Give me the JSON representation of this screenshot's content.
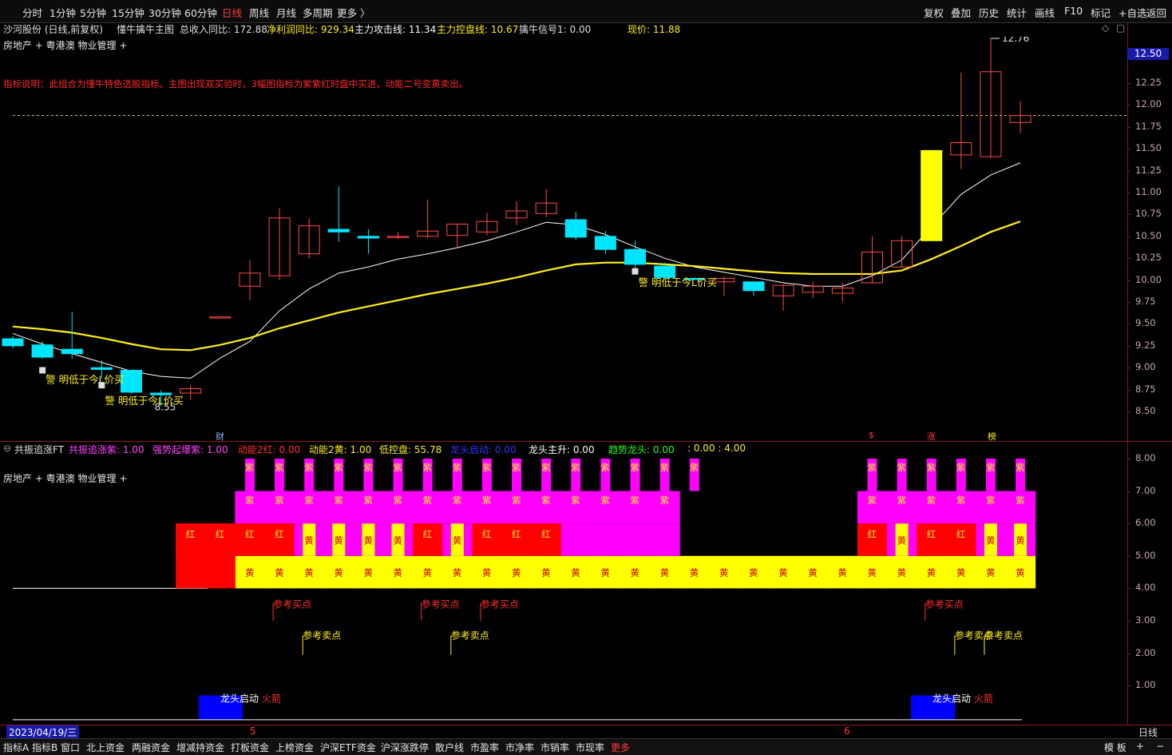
{
  "topbar": {
    "periods": [
      "分时",
      "1分钟",
      "5分钟",
      "15分钟",
      "30分钟",
      "60分钟",
      "日线",
      "周线",
      "月线",
      "多周期",
      "更多 〉"
    ],
    "active_period": "日线",
    "right_buttons": [
      "复权",
      "叠加",
      "历史",
      "统计",
      "画线",
      "F10",
      "标记",
      "+自选",
      "返回"
    ]
  },
  "main_info": {
    "stock": "沙河股份 (日线,前复权)",
    "indicator": "懂牛擒牛主图",
    "revenue_yoy": "总收入同比: 172.88",
    "profit_yoy": "净利润同比: 929.34",
    "attack_line": "主力攻击线: 11.34",
    "control_line": "主力控盘线: 10.67",
    "signal1": "擒牛信号1: 0.00",
    "price": "现价: 11.88",
    "sector": "房地产 + 粤港澳 物业管理 +",
    "description": "指标说明：此组合为懂牛特色选股指标。主图出现双买验时，3幅图指标为紫紫红时盘中买进，动能二号变黄卖出。"
  },
  "colors": {
    "up": "#ff4b4b",
    "down": "#00e5ff",
    "attack": "#ffffff",
    "control": "#ffee22",
    "purple": "#ff00ff",
    "red": "#ff0000",
    "yellow": "#ffff00",
    "blue": "#0000ff",
    "axis": "#7a1a1a"
  },
  "price_axis": {
    "labels": [
      "12.50",
      "12.25",
      "12.00",
      "11.75",
      "11.50",
      "11.25",
      "11.00",
      "10.75",
      "10.50",
      "10.25",
      "10.00",
      "9.75",
      "9.50",
      "9.25",
      "9.00",
      "8.75",
      "8.50"
    ],
    "current": "12.50",
    "high_label": "12.76",
    "low_label": "8.55"
  },
  "chart_data": [
    {
      "type": "candlestick",
      "title": "懂牛擒牛主图",
      "ylim": [
        8.4,
        12.85
      ],
      "candles": [
        {
          "o": 9.33,
          "h": 9.36,
          "l": 9.22,
          "c": 9.25
        },
        {
          "o": 9.26,
          "h": 9.3,
          "l": 9.1,
          "c": 9.12
        },
        {
          "o": 9.21,
          "h": 9.64,
          "l": 9.1,
          "c": 9.16
        },
        {
          "o": 9.0,
          "h": 9.08,
          "l": 8.88,
          "c": 8.98
        },
        {
          "o": 8.97,
          "h": 8.98,
          "l": 8.7,
          "c": 8.72
        },
        {
          "o": 8.71,
          "h": 8.74,
          "l": 8.56,
          "c": 8.69
        },
        {
          "o": 8.71,
          "h": 8.8,
          "l": 8.63,
          "c": 8.76
        },
        {
          "o": 9.58,
          "h": 9.58,
          "l": 9.58,
          "c": 9.58
        },
        {
          "o": 9.93,
          "h": 10.23,
          "l": 9.77,
          "c": 10.08
        },
        {
          "o": 10.05,
          "h": 10.82,
          "l": 10.0,
          "c": 10.71
        },
        {
          "o": 10.3,
          "h": 10.7,
          "l": 10.25,
          "c": 10.62
        },
        {
          "o": 10.58,
          "h": 11.07,
          "l": 10.44,
          "c": 10.55
        },
        {
          "o": 10.5,
          "h": 10.58,
          "l": 10.3,
          "c": 10.48
        },
        {
          "o": 10.5,
          "h": 10.55,
          "l": 10.47,
          "c": 10.5
        },
        {
          "o": 10.5,
          "h": 10.92,
          "l": 10.48,
          "c": 10.56
        },
        {
          "o": 10.51,
          "h": 10.64,
          "l": 10.37,
          "c": 10.64
        },
        {
          "o": 10.55,
          "h": 10.77,
          "l": 10.51,
          "c": 10.67
        },
        {
          "o": 10.71,
          "h": 10.9,
          "l": 10.63,
          "c": 10.79
        },
        {
          "o": 10.76,
          "h": 11.04,
          "l": 10.72,
          "c": 10.88
        },
        {
          "o": 10.69,
          "h": 10.78,
          "l": 10.46,
          "c": 10.49
        },
        {
          "o": 10.5,
          "h": 10.56,
          "l": 10.3,
          "c": 10.35
        },
        {
          "o": 10.35,
          "h": 10.45,
          "l": 10.14,
          "c": 10.18
        },
        {
          "o": 10.16,
          "h": 10.2,
          "l": 10.01,
          "c": 10.03
        },
        {
          "o": 10.02,
          "h": 10.03,
          "l": 10.0,
          "c": 10.01
        },
        {
          "o": 9.98,
          "h": 10.04,
          "l": 9.82,
          "c": 10.02
        },
        {
          "o": 9.98,
          "h": 9.98,
          "l": 9.82,
          "c": 9.88
        },
        {
          "o": 9.82,
          "h": 9.95,
          "l": 9.65,
          "c": 9.94
        },
        {
          "o": 9.86,
          "h": 9.98,
          "l": 9.8,
          "c": 9.93
        },
        {
          "o": 9.85,
          "h": 9.97,
          "l": 9.75,
          "c": 9.91
        },
        {
          "o": 9.97,
          "h": 10.5,
          "l": 9.97,
          "c": 10.32
        },
        {
          "o": 10.15,
          "h": 10.5,
          "l": 10.14,
          "c": 10.45
        },
        {
          "o": 10.45,
          "h": 11.48,
          "l": 10.45,
          "c": 11.48
        },
        {
          "o": 11.43,
          "h": 12.37,
          "l": 11.27,
          "c": 11.57
        },
        {
          "o": 11.41,
          "h": 12.76,
          "l": 11.4,
          "c": 12.38
        },
        {
          "o": 11.8,
          "h": 12.04,
          "l": 11.68,
          "c": 11.88
        }
      ],
      "series": [
        {
          "name": "主力攻击线",
          "values": [
            9.39,
            9.27,
            9.16,
            9.06,
            8.96,
            8.9,
            8.88,
            9.11,
            9.3,
            9.65,
            9.9,
            10.08,
            10.15,
            10.24,
            10.3,
            10.37,
            10.45,
            10.55,
            10.66,
            10.63,
            10.52,
            10.38,
            10.25,
            10.15,
            10.09,
            10.03,
            9.97,
            9.93,
            9.93,
            10.05,
            10.23,
            10.61,
            10.98,
            11.2,
            11.34
          ]
        },
        {
          "name": "主力控盘线",
          "values": [
            9.47,
            9.44,
            9.4,
            9.34,
            9.27,
            9.21,
            9.2,
            9.26,
            9.34,
            9.45,
            9.54,
            9.63,
            9.7,
            9.77,
            9.84,
            9.9,
            9.96,
            10.03,
            10.11,
            10.18,
            10.2,
            10.2,
            10.18,
            10.16,
            10.13,
            10.1,
            10.08,
            10.07,
            10.07,
            10.07,
            10.11,
            10.24,
            10.39,
            10.55,
            10.67
          ]
        }
      ]
    },
    {
      "type": "bar",
      "title": "共振追涨FT",
      "ylim": [
        0,
        8.4
      ],
      "series": [
        {
          "name": "共振追涨紫",
          "values": [
            0,
            0,
            0,
            0,
            0,
            0,
            0,
            0,
            1,
            1,
            1,
            1,
            1,
            1,
            1,
            1,
            1,
            1,
            1,
            1,
            1,
            1,
            1,
            1,
            0,
            0,
            0,
            0,
            0,
            1,
            1,
            1,
            1,
            1,
            1
          ]
        },
        {
          "name": "强势起爆紫",
          "values": [
            0,
            0,
            0,
            0,
            0,
            0,
            0,
            0,
            1,
            1,
            1,
            1,
            1,
            1,
            1,
            1,
            1,
            1,
            1,
            1,
            1,
            1,
            1,
            0,
            0,
            0,
            0,
            0,
            0,
            1,
            1,
            1,
            1,
            1,
            1
          ]
        },
        {
          "name": "动能2红",
          "values": [
            0,
            0,
            0,
            0,
            0,
            0,
            1,
            1,
            1,
            1,
            0,
            0,
            0,
            0,
            1,
            0,
            1,
            1,
            1,
            0,
            0,
            0,
            0,
            0,
            0,
            0,
            0,
            0,
            0,
            1,
            0,
            1,
            1,
            0,
            0
          ]
        },
        {
          "name": "动能2黄",
          "values": [
            0,
            0,
            0,
            0,
            0,
            0,
            0,
            0,
            1,
            1,
            1,
            1,
            1,
            1,
            1,
            1,
            1,
            1,
            1,
            1,
            1,
            1,
            1,
            1,
            1,
            1,
            1,
            1,
            1,
            1,
            1,
            1,
            1,
            1,
            1
          ]
        }
      ]
    }
  ],
  "markers": {
    "cai": "财",
    "s": "$",
    "zhang": "涨",
    "bang": "榜"
  },
  "warnings": [
    "警 明低于今L价买",
    "警 明低于今L价买",
    "警 明低于今L价买"
  ],
  "sub_info": {
    "name": "共振追涨FT",
    "v1": "共振追涨紫: 1.00",
    "v2": "强势起爆紫: 1.00",
    "v3": "动能2红: 0.00",
    "v4": "动能2黄: 1.00",
    "v5": "低控盘: 55.78",
    "v6": "龙头启动: 0.00",
    "v7": "龙头主升: 0.00",
    "v8": "趋势龙头: 0.00",
    "v9": ": 0.00 : 4.00",
    "sector": "房地产 + 粤港澳 物业管理 +"
  },
  "sub_axis": {
    "labels": [
      "8.00",
      "7.00",
      "6.00",
      "5.00",
      "4.00",
      "3.00",
      "2.00",
      "1.00"
    ]
  },
  "block_labels": {
    "purple": "紫",
    "red": "红",
    "yellow": "黄"
  },
  "signals": {
    "buy": "参考买点",
    "sell": "参考卖点",
    "dragon": "龙头启动",
    "rocket": "火箭"
  },
  "date_bar": {
    "date": "2023/04/19/三",
    "m5": "5",
    "m6": "6",
    "period": "日线"
  },
  "bottombar": {
    "items": [
      "指标A",
      "指标B",
      "窗口",
      "北上资金",
      "两融资金",
      "增减持资金",
      "打板资金",
      "上榜资金",
      "沪深ETF资金",
      "沪深涨跌停",
      "散户线",
      "市盈率",
      "市净率",
      "市销率",
      "市现率",
      "更多"
    ],
    "right": [
      "模 板",
      "+",
      "−"
    ]
  }
}
